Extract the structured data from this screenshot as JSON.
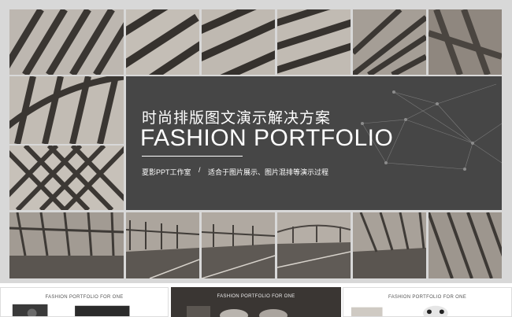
{
  "slide": {
    "title_cn": "时尚排版图文演示解决方案",
    "title_en": "FASHION PORTFOLIO",
    "subtitle_left": "夏影PPT工作室",
    "subtitle_separator": "/",
    "subtitle_right": "适合于图片展示、图片混排等演示过程"
  },
  "thumbnails": [
    {
      "caption": "FASHION PORTFOLIO FOR ONE"
    },
    {
      "caption": "FASHION PORTFOLIO FOR ONE"
    },
    {
      "caption": "FASHION PORTFOLIO FOR ONE"
    }
  ],
  "colors": {
    "panel": "#464646",
    "photo_tone": "#8a8178",
    "background": "#d8d8d8"
  }
}
